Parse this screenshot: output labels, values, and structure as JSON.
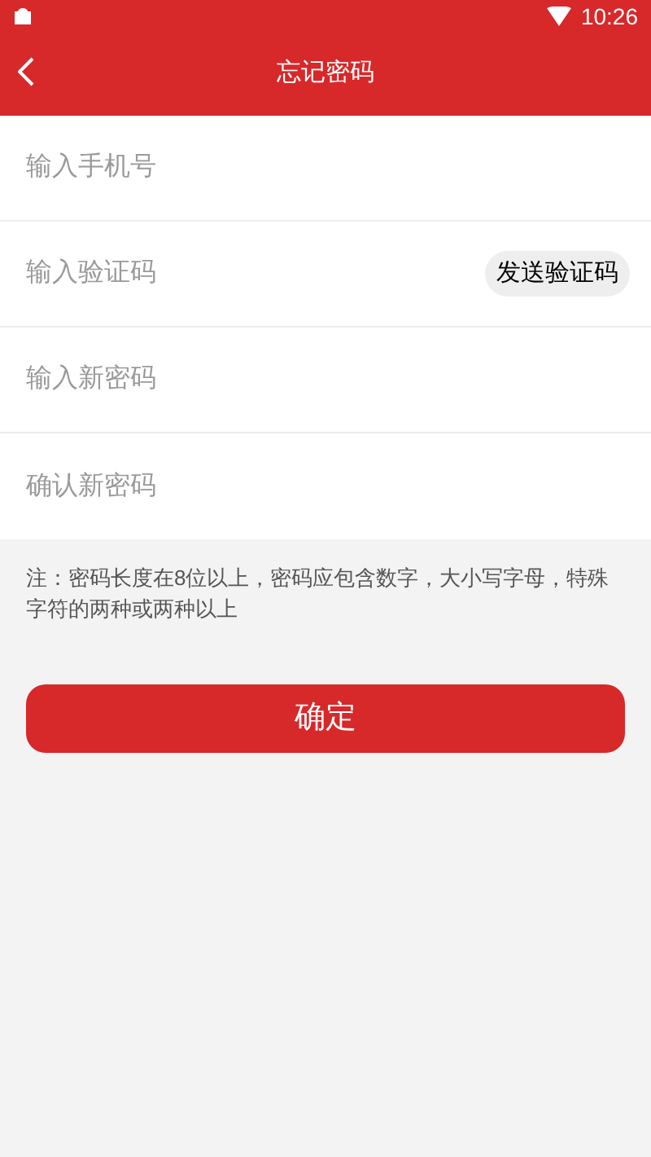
{
  "status_bar": {
    "time": "10:26"
  },
  "header": {
    "title": "忘记密码"
  },
  "fields": [
    {
      "placeholder": "输入手机号",
      "kind": "text"
    },
    {
      "placeholder": "输入验证码",
      "kind": "code",
      "action": "发送验证码"
    },
    {
      "placeholder": "输入新密码",
      "kind": "password"
    },
    {
      "placeholder": "确认新密码",
      "kind": "password"
    }
  ],
  "note": "注：密码长度在8位以上，密码应包含数字，大小写字母，特殊字符的两种或两种以上",
  "submit": "确定"
}
